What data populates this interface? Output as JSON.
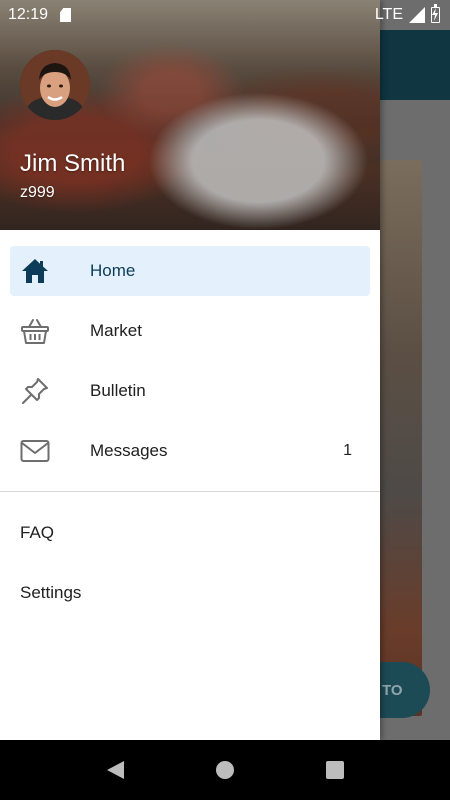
{
  "status_bar": {
    "time": "12:19",
    "network": "LTE"
  },
  "background_app": {
    "fab_label": "TO"
  },
  "drawer": {
    "user": {
      "name": "Jim Smith",
      "id": "z999"
    },
    "menu": [
      {
        "label": "Home",
        "icon": "home-icon",
        "active": true
      },
      {
        "label": "Market",
        "icon": "basket-icon",
        "active": false
      },
      {
        "label": "Bulletin",
        "icon": "pushpin-icon",
        "active": false
      },
      {
        "label": "Messages",
        "icon": "mail-icon",
        "active": false,
        "count": "1"
      }
    ],
    "secondary": [
      {
        "label": "FAQ"
      },
      {
        "label": "Settings"
      }
    ]
  },
  "colors": {
    "accent": "#0d3c58",
    "active_bg": "#e4f1fc",
    "toolbar": "#103642"
  }
}
